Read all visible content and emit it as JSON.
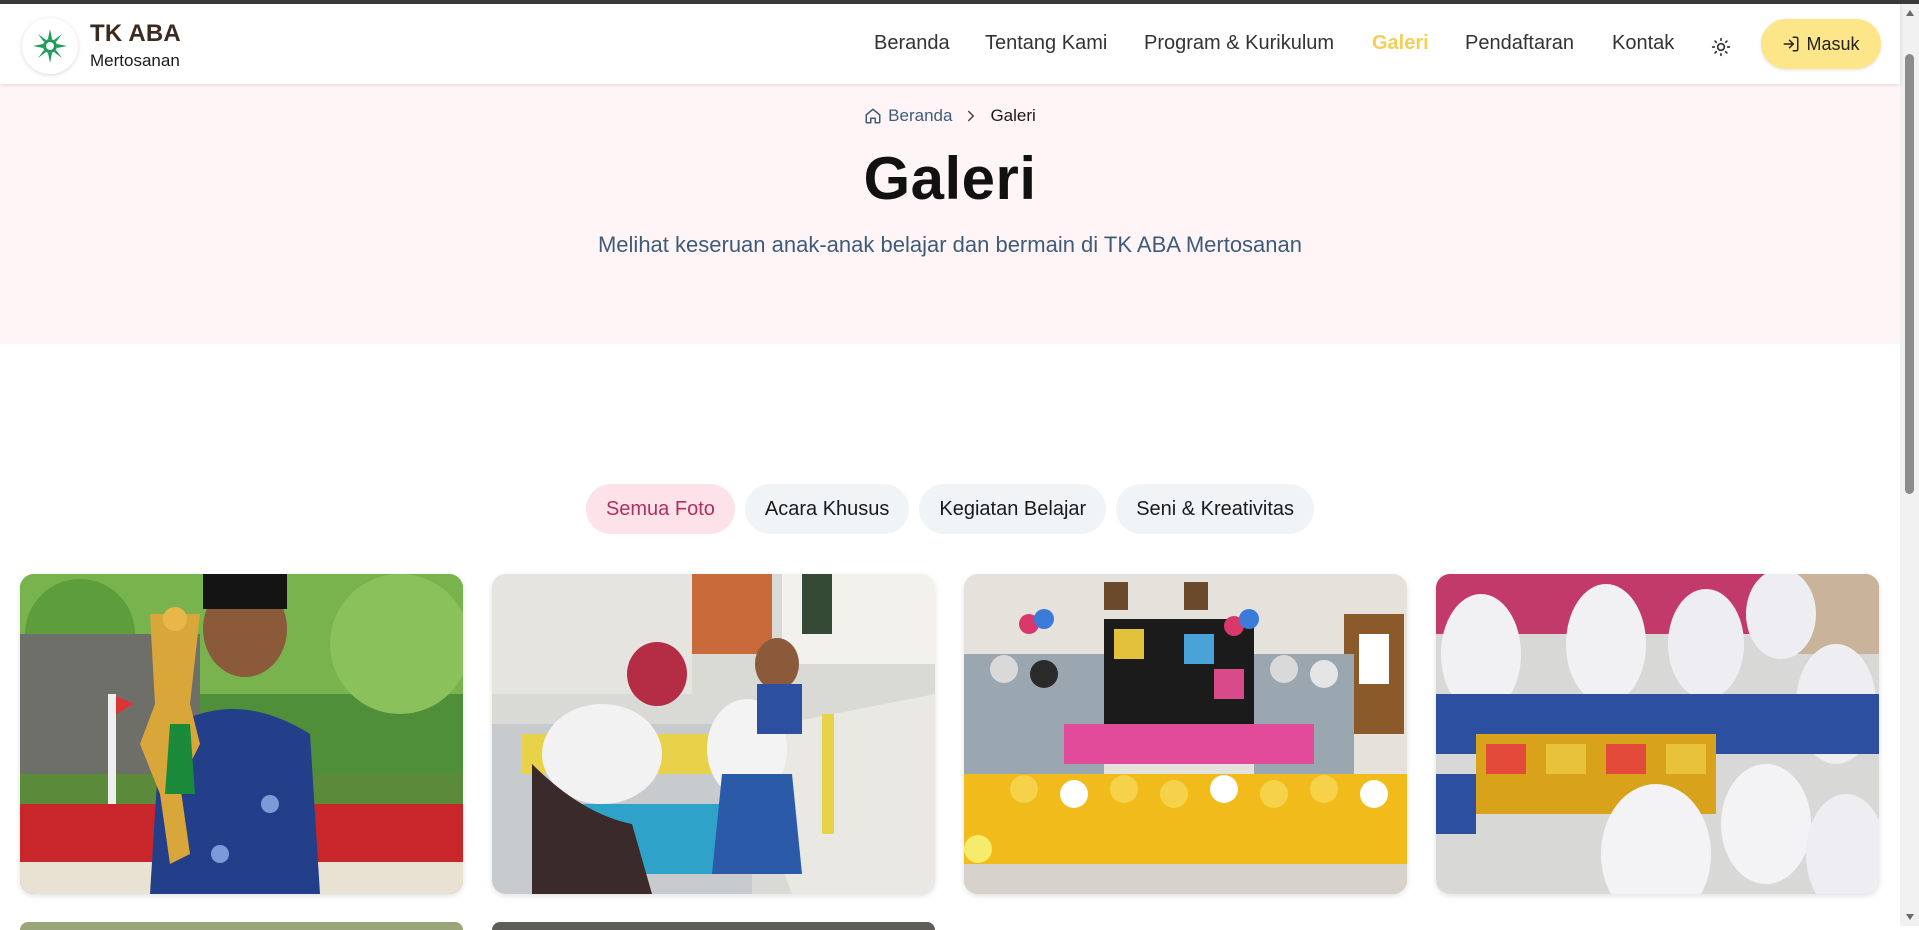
{
  "brand": {
    "title": "TK ABA",
    "subtitle": "Mertosanan"
  },
  "nav": {
    "items": [
      {
        "label": "Beranda"
      },
      {
        "label": "Tentang Kami"
      },
      {
        "label": "Program & Kurikulum"
      },
      {
        "label": "Galeri",
        "active": true
      },
      {
        "label": "Pendaftaran"
      },
      {
        "label": "Kontak"
      }
    ],
    "theme_icon": "sun-icon",
    "login_label": "Masuk",
    "login_icon": "log-in-icon"
  },
  "breadcrumb": {
    "home_label": "Beranda",
    "current_label": "Galeri"
  },
  "hero": {
    "title": "Galeri",
    "subtitle": "Melihat keseruan anak-anak belajar dan bermain di TK ABA Mertosanan"
  },
  "filters": [
    {
      "label": "Semua Foto",
      "active": true
    },
    {
      "label": "Acara Khusus"
    },
    {
      "label": "Kegiatan Belajar"
    },
    {
      "label": "Seni & Kreativitas"
    }
  ],
  "gallery": [
    {
      "scene": "boy-with-trophy"
    },
    {
      "scene": "children-writing-at-tables"
    },
    {
      "scene": "group-photo-celebration"
    },
    {
      "scene": "children-in-hijab-on-floor"
    }
  ],
  "colors": {
    "accent_yellow": "#fde68a",
    "active_nav": "#f3cf5a",
    "hero_bg": "#fff5f7",
    "filter_active_bg": "#fde2ea",
    "filter_active_text": "#b0305e",
    "subtitle_blue": "#3e5c7a"
  }
}
